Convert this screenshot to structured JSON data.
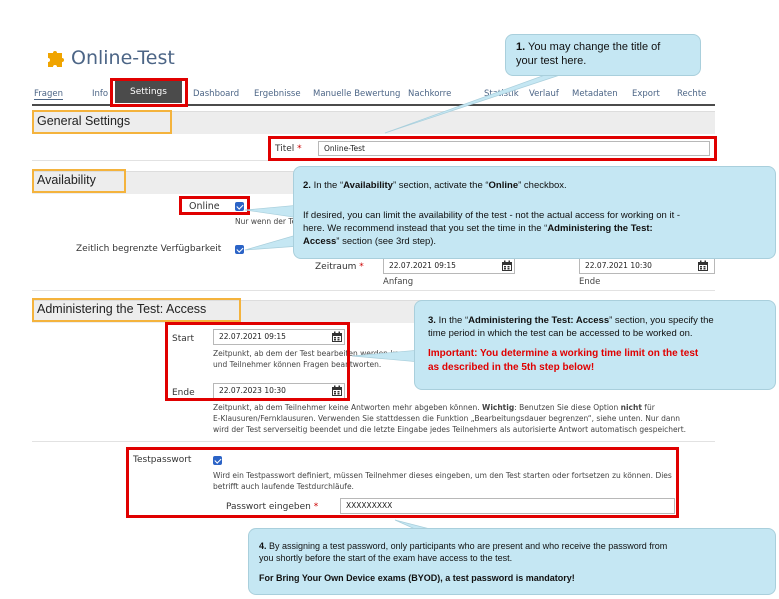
{
  "app": {
    "title": "Online-Test"
  },
  "tabs": [
    {
      "label": "Fragen"
    },
    {
      "label": "Info"
    },
    {
      "label": "Settings"
    },
    {
      "label": "Dashboard"
    },
    {
      "label": "Ergebnisse"
    },
    {
      "label": "Manuelle Bewertung"
    },
    {
      "label": "Nachkorre"
    },
    {
      "label": "Statistik"
    },
    {
      "label": "Verlauf"
    },
    {
      "label": "Metadaten"
    },
    {
      "label": "Export"
    },
    {
      "label": "Rechte"
    }
  ],
  "general": {
    "heading": "General Settings",
    "title_label": "Titel",
    "required": "*",
    "title_value": "Online-Test"
  },
  "availability": {
    "heading": "Availability",
    "online_label": "Online",
    "online_help": "Nur wenn der Test onl",
    "limited_label": "Zeitlich begrenzte Verfügbarkeit",
    "period_label": "Zeitraum",
    "start_value": "22.07.2021 09:15",
    "start_caption": "Anfang",
    "end_value": "22.07.2021 10:30",
    "end_caption": "Ende"
  },
  "access": {
    "heading": "Administering the Test: Access",
    "start_label": "Start",
    "start_value": "22.07.2021 09:15",
    "start_help_1": "Zeitpunkt, ab dem der Test bearbeiten werden kann. A",
    "start_help_2": "und Teilnehmer können Fragen beantworten.",
    "end_label": "Ende",
    "end_value": "22.07.2023 10:30",
    "end_help_1": "Zeitpunkt, ab dem Teilnehmer keine Antworten mehr abgeben können. ",
    "end_help_1_bold": "Wichtig",
    "end_help_1_tail": ": Benutzen Sie diese Option ",
    "end_help_1_bold2": "nicht",
    "end_help_1_tail2": " für",
    "end_help_2": "E-Klausuren/Fernklausuren. Verwenden Sie stattdessen die Funktion „Bearbeitungsdauer begrenzen“, siehe unten. Nur dann",
    "end_help_3": "wird der Test serverseitig beendet und die letzte Eingabe jedes Teilnehmers als autorisierte Antwort automatisch gespeichert.",
    "password_label": "Testpasswort",
    "password_help_1": "Wird ein Testpasswort definiert, müssen Teilnehmer dieses eingeben, um den Test starten oder fortsetzen zu können. Dies",
    "password_help_2": "betrifft auch laufende Testdurchläufe.",
    "password_input_label": "Passwort eingeben",
    "password_value": "XXXXXXXXX"
  },
  "callouts": {
    "c1_num": "1.",
    "c1_text_1": " You may change the title of",
    "c1_text_2": "your test here.",
    "c2_line1_pre": "2.",
    "c2_line1_a": " In the “",
    "c2_line1_b": "Availability",
    "c2_line1_c": "” section, activate the “",
    "c2_line1_d": "Online",
    "c2_line1_e": "” checkbox.",
    "c2_line2": "If desired, you can limit the availability of the test - not the actual access for working on it -",
    "c2_line3_a": "here. We recommend instead that you set the time in the “",
    "c2_line3_b": "Administering the Test:",
    "c2_line4_a": "Access",
    "c2_line4_b": "” section (see 3rd step).",
    "c3_line1_num": "3.",
    "c3_line1_a": " In the “",
    "c3_line1_b": "Administering the Test: Access",
    "c3_line1_c": "” section, you specify the",
    "c3_line2": "time period in which the test can be accessed to be worked on.",
    "c3_important_1": "Important: You determine a working time limit on the test",
    "c3_important_2": "as described in the 5th step below!",
    "c4_line1_num": "4.",
    "c4_line1": " By assigning a test password, only participants who are present and who receive the password from",
    "c4_line2": "you shortly before the start of the exam have access to the test.",
    "c4_line3": "For Bring Your Own Device exams (BYOD), a test password is mandatory!"
  },
  "colors": {
    "accent_red": "#e00000",
    "section_orange": "#f4b33d",
    "bubble": "#c5e7f3",
    "link_blue": "#4c6586",
    "checkbox": "#2b63c6",
    "important": "#e00000"
  },
  "icons": {
    "logo": "puzzle-icon",
    "calendar": "calendar-icon",
    "checkbox": "checkbox-checked-icon"
  }
}
